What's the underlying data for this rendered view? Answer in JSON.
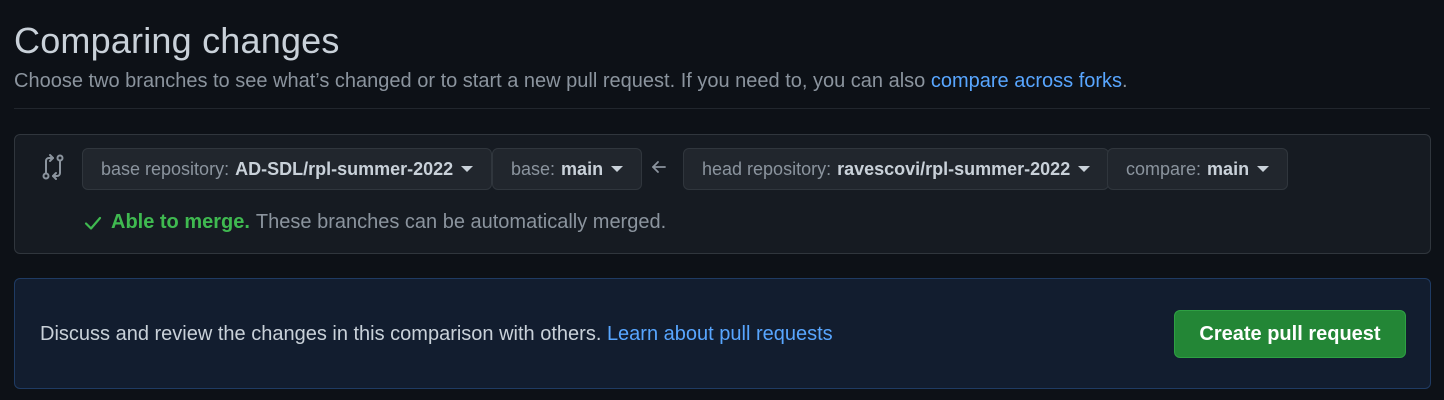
{
  "header": {
    "title": "Comparing changes",
    "subtitle": "Choose two branches to see what’s changed or to start a new pull request. If you need to, you can also ",
    "subtitle_link": "compare across forks",
    "subtitle_end": "."
  },
  "range": {
    "base_repo": {
      "label": "base repository:",
      "value": "AD-SDL/rpl-summer-2022"
    },
    "base_branch": {
      "label": "base:",
      "value": "main"
    },
    "head_repo": {
      "label": "head repository:",
      "value": "ravescovi/rpl-summer-2022"
    },
    "compare_branch": {
      "label": "compare:",
      "value": "main"
    },
    "merge_status": {
      "status": "Able to merge.",
      "message": "These branches can be automatically merged."
    }
  },
  "pr": {
    "text": "Discuss and review the changes in this comparison with others. ",
    "link": "Learn about pull requests",
    "create_label": "Create pull request"
  },
  "icons": {
    "compare": "git-compare-icon",
    "arrow": "arrow-left-icon",
    "check": "check-icon",
    "caret": "triangle-down-icon"
  },
  "colors": {
    "background": "#0d1117",
    "link": "#58a6ff",
    "success": "#3fb950",
    "primary_button": "#238636"
  }
}
